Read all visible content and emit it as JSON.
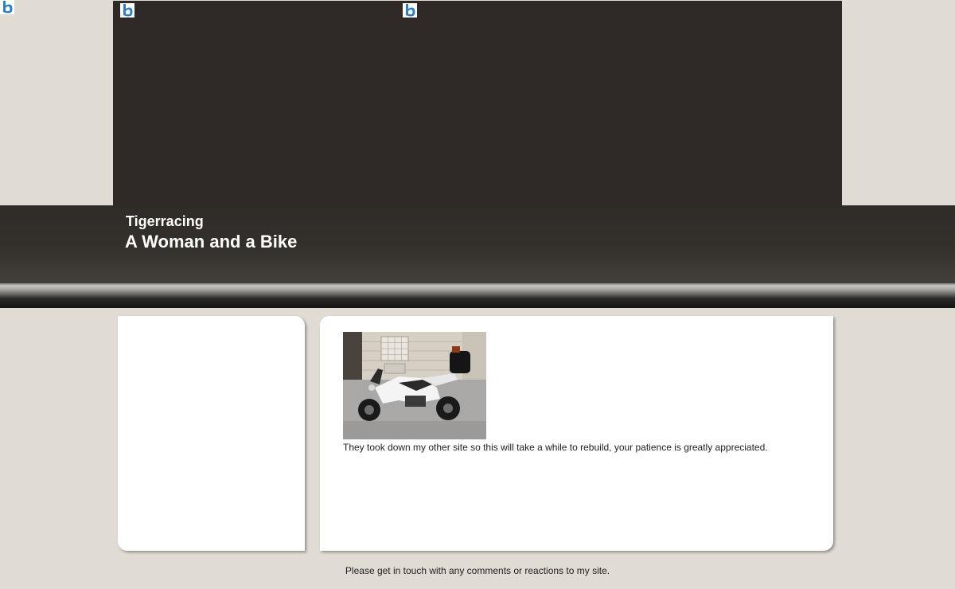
{
  "header": {
    "site_name": "Tigerracing",
    "tagline": "A Woman and a Bike"
  },
  "main": {
    "body_text": "They took down my other site so this will take a while to rebuild, your patience is greatly appreciated."
  },
  "footer": {
    "text": "Please get in touch with any comments or reactions to my site."
  },
  "icons": {
    "logo": "b-logo-icon"
  },
  "colors": {
    "page_background": "#e0dcd3",
    "banner": "#2e2926",
    "logo_blue": "#2f7fc4"
  }
}
